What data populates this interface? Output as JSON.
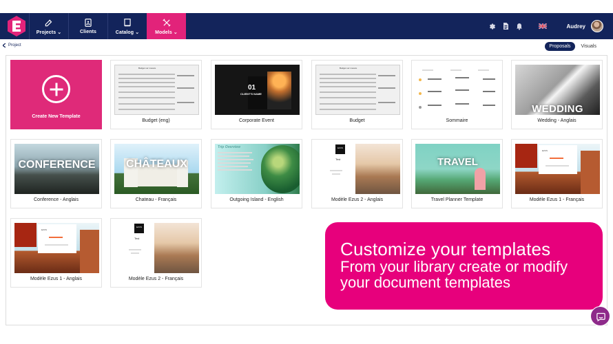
{
  "nav": {
    "projects": "Projects",
    "clients": "Clients",
    "catalog": "Catalog",
    "models": "Models",
    "chevron": "⌄"
  },
  "user": {
    "name": "Audrey"
  },
  "subbar": {
    "back": "Project",
    "proposals": "Proposals",
    "visuals": "Visuals"
  },
  "templates": [
    {
      "title": "Create New Template"
    },
    {
      "title": "Budget (eng)"
    },
    {
      "title": "Corporate Event"
    },
    {
      "title": "Budget"
    },
    {
      "title": "Sommaire"
    },
    {
      "title": "Wedding - Anglais"
    },
    {
      "title": "Conference - Anglais"
    },
    {
      "title": "Chateau - Français"
    },
    {
      "title": "Outgoing Island - English"
    },
    {
      "title": "Modèle Ezus 2 - Anglais"
    },
    {
      "title": "Travel Planner Template"
    },
    {
      "title": "Modèle Ezus 1 - Français"
    },
    {
      "title": "Modèle Ezus 1 - Anglais"
    },
    {
      "title": "Modèle Ezus 2 - Français"
    }
  ],
  "thumb_text": {
    "budget_title": "Budget sur mesure",
    "corporate_number": "01",
    "corporate_name": "CLIENT'S NAME",
    "wedding": "WEDDING",
    "conference": "CONFERENCE",
    "chateau": "CHÂTEAUX",
    "trip": "Trip Overview",
    "test": "Test",
    "travel": "TRAVEL",
    "brand": "EZUS"
  },
  "promo": {
    "headline": "Customize your templates",
    "line1": "From your library create or modify",
    "line2": "your document templates"
  },
  "colors": {
    "navy": "#13245b",
    "pink": "#e2237a",
    "chat": "#8e2a8a"
  }
}
